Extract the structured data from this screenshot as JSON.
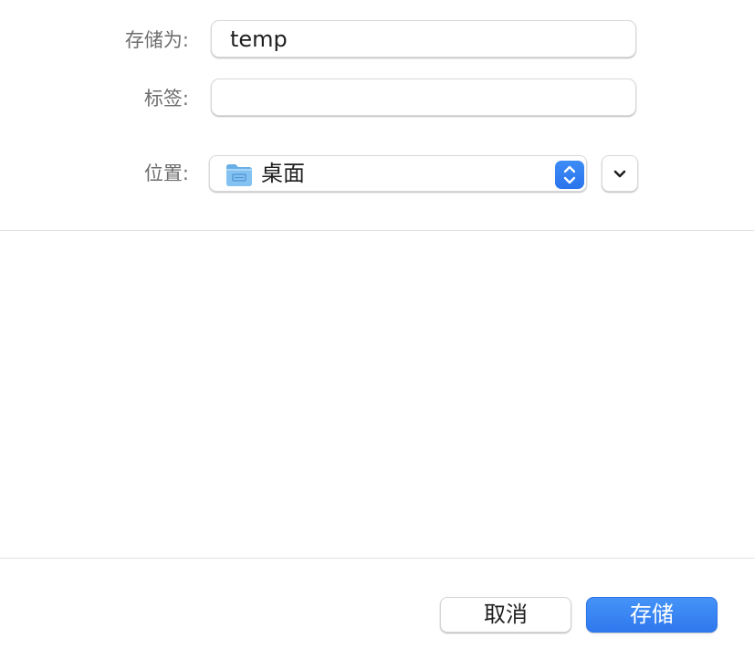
{
  "form": {
    "save_as_label": "存储为:",
    "save_as_value": "temp",
    "tags_label": "标签:",
    "tags_value": "",
    "location_label": "位置:",
    "location_value": "桌面",
    "location_icon": "folder-icon"
  },
  "buttons": {
    "cancel_label": "取消",
    "save_label": "存储"
  },
  "colors": {
    "accent": "#3b82f6",
    "folder": "#7ab8ec"
  }
}
